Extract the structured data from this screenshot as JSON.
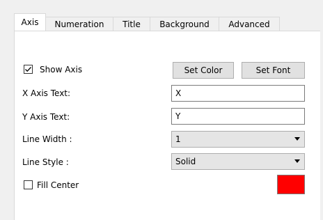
{
  "tabs": [
    {
      "label": "Axis",
      "active": true
    },
    {
      "label": "Numeration",
      "active": false
    },
    {
      "label": "Title",
      "active": false
    },
    {
      "label": "Background",
      "active": false
    },
    {
      "label": "Advanced",
      "active": false
    }
  ],
  "show_axis": {
    "label": "Show Axis",
    "checked": true
  },
  "buttons": {
    "set_color": "Set Color",
    "set_font": "Set Font"
  },
  "x_axis": {
    "label": "X Axis Text:",
    "value": "X"
  },
  "y_axis": {
    "label": "Y Axis Text:",
    "value": "Y"
  },
  "line_width": {
    "label": "Line Width :",
    "value": "1",
    "icon": "chevron-down-icon"
  },
  "line_style": {
    "label": "Line Style :",
    "value": "Solid",
    "icon": "chevron-down-icon"
  },
  "fill_center": {
    "label": "Fill Center",
    "checked": false,
    "color": "#ff0000"
  }
}
